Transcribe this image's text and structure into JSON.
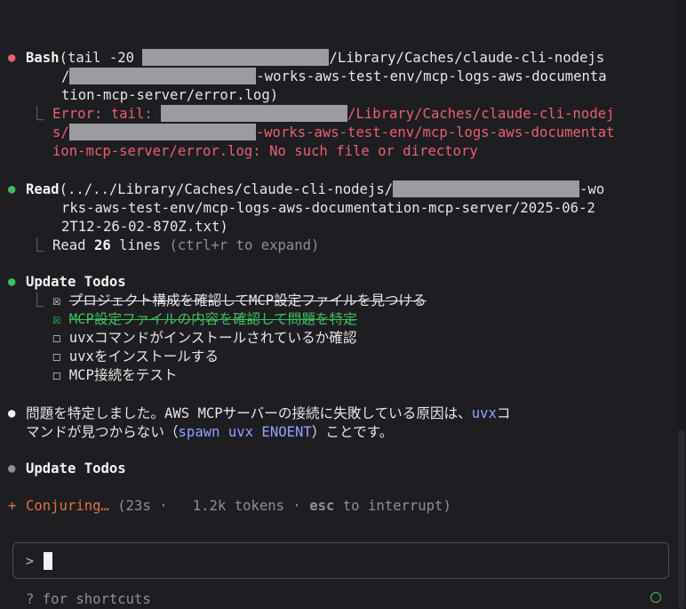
{
  "blocks": {
    "bash": {
      "tool": "Bash",
      "line1_pre": "(tail -20 ",
      "line1_post": "/Library/Caches/claude-cli-nodejs",
      "line2_pre": "/",
      "line2_post": "-works-aws-test-env/mcp-logs-aws-documenta",
      "line3": "tion-mcp-server/error.log)",
      "err1_pre": "Error: tail: ",
      "err1_post": "/Library/Caches/claude-cli-nodej",
      "err2_pre": "s/",
      "err2_post": "-works-aws-test-env/mcp-logs-aws-documentat",
      "err3": "ion-mcp-server/error.log: No such file or directory",
      "branch": "⎿"
    },
    "read": {
      "tool": "Read",
      "line1_pre": "(../../Library/Caches/claude-cli-nodejs/",
      "line1_post": "-wo",
      "line2": "rks-aws-test-env/mcp-logs-aws-documentation-mcp-server/2025-06-2",
      "line3": "2T12-26-02-870Z.txt)",
      "result_pre": "Read ",
      "result_count": "26",
      "result_post": " lines ",
      "result_hint": "(ctrl+r to expand)",
      "branch": "⎿"
    },
    "todos": {
      "tool": "Update Todos",
      "branch": "⎿",
      "items": [
        {
          "box": "☒",
          "text": "プロジェクト構成を確認してMCP設定ファイルを見つける"
        },
        {
          "box": "☒",
          "text": "MCP設定ファイルの内容を確認して問題を特定"
        },
        {
          "box": "☐",
          "text": "uvxコマンドがインストールされているか確認"
        },
        {
          "box": "☐",
          "text": "uvxをインストールする"
        },
        {
          "box": "☐",
          "text": "MCP接続をテスト"
        }
      ]
    },
    "message": {
      "line1_pre": "問題を特定しました。AWS MCPサーバーの接続に失敗している原因は、",
      "line1_code": "uvx",
      "line1_post": "コ",
      "line2_pre": "マンドが見つからない（",
      "line2_code": "spawn uvx ENOENT",
      "line2_post": "）ことです。"
    },
    "todos2": {
      "tool": "Update Todos"
    },
    "status": {
      "spinner": "+",
      "label": "Conjuring…",
      "detail_pre": " (23s ·   1.2k tokens · ",
      "detail_key": "esc",
      "detail_post": " to interrupt)"
    }
  },
  "prompt": {
    "symbol": ">",
    "value": ""
  },
  "footer": {
    "hint": "? for shortcuts"
  },
  "colors": {
    "error": "#e8606f",
    "success": "#3fbf5f",
    "accent": "#8fa3ff",
    "spinner": "#e0703f",
    "background": "#1e1e22"
  }
}
